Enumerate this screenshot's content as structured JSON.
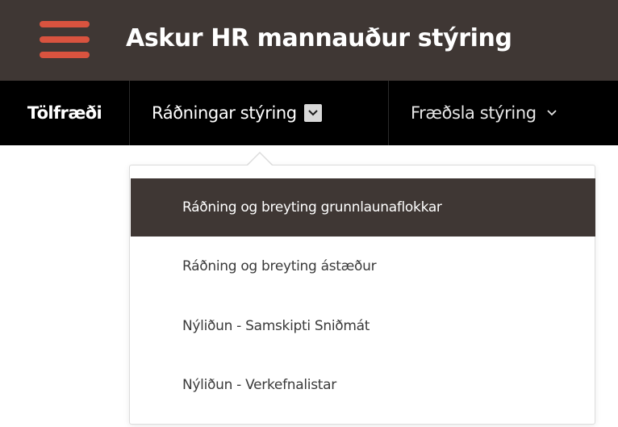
{
  "header": {
    "menu_icon": "hamburger-menu-icon",
    "title": "Askur HR mannauður stýring",
    "accent_color": "#d9533f",
    "background_color": "#3f3734"
  },
  "nav": {
    "items": [
      {
        "label": "Tölfræði"
      },
      {
        "label": "Ráðningar stýring",
        "icon": "chevron-down-icon",
        "expanded": true
      },
      {
        "label": "Fræðsla stýring",
        "icon": "chevron-down-icon"
      }
    ]
  },
  "dropdown": {
    "items": [
      {
        "label": "Ráðning og breyting grunnlaunaflokkar",
        "highlighted": true
      },
      {
        "label": "Ráðning og breyting ástæður"
      },
      {
        "label": "Nýliðun - Samskipti Sniðmát"
      },
      {
        "label": "Nýliðun - Verkefnalistar"
      }
    ]
  }
}
